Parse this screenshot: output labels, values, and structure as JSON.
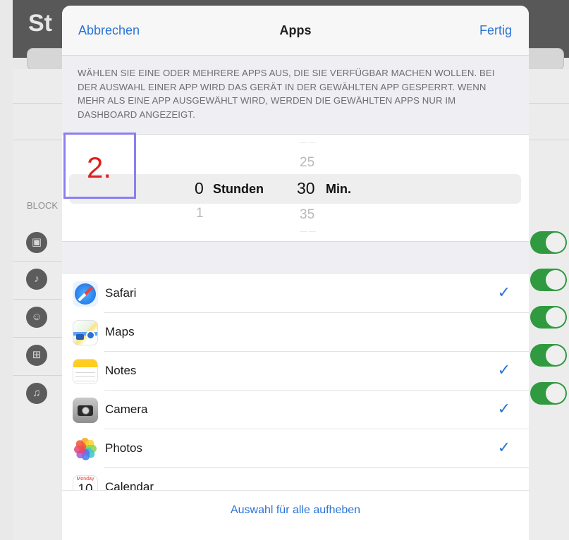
{
  "background": {
    "title_fragment": "St",
    "section_label": "BLOCK",
    "icons": [
      "speech-bubble-icon",
      "guitar-icon",
      "people-icon",
      "cart-icon",
      "music-note-icon"
    ]
  },
  "modal": {
    "nav": {
      "cancel_label": "Abbrechen",
      "title": "Apps",
      "done_label": "Fertig"
    },
    "description": "WÄHLEN SIE EINE ODER MEHRERE APPS AUS, DIE SIE VERFÜGBAR MACHEN WOLLEN. BEI DER AUSWAHL EINER APP WIRD DAS GERÄT IN DER GEWÄHLTEN APP GESPERRT. WENN MEHR ALS EINE APP AUSGEWÄHLT WIRD, WERDEN DIE GEWÄHLTEN APPS NUR IM DASHBOARD ANGEZEIGT.",
    "picker": {
      "hours_selected": "0",
      "hours_unit": "Stunden",
      "hours_below": "1",
      "minutes_above": "25",
      "minutes_selected": "30",
      "minutes_unit": "Min.",
      "minutes_below": "35"
    },
    "annotation_label": "2.",
    "apps": [
      {
        "name": "Safari",
        "icon": "safari-icon",
        "checked": true,
        "check": "✓"
      },
      {
        "name": "Maps",
        "icon": "maps-icon",
        "checked": false,
        "check": ""
      },
      {
        "name": "Notes",
        "icon": "notes-icon",
        "checked": true,
        "check": "✓"
      },
      {
        "name": "Camera",
        "icon": "camera-icon",
        "checked": true,
        "check": "✓"
      },
      {
        "name": "Photos",
        "icon": "photos-icon",
        "checked": true,
        "check": "✓"
      },
      {
        "name": "Calendar",
        "icon": "calendar-icon",
        "checked": false,
        "check": "",
        "icon_day": "Monday",
        "icon_date": "10"
      }
    ],
    "footer_link": "Auswahl für alle aufheben"
  },
  "colors": {
    "accent": "#2a73d6",
    "toggle_on": "#2f9a3f",
    "annotation_frame": "#8b7ff0",
    "annotation_text": "#e02020"
  }
}
